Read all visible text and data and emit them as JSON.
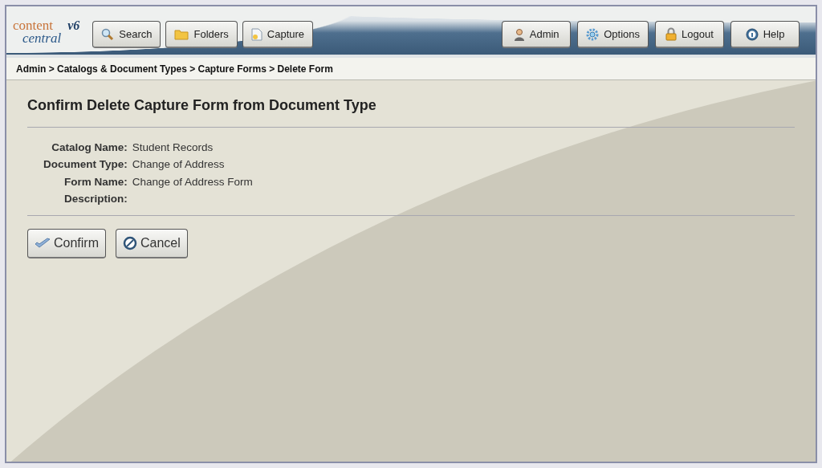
{
  "logo": {
    "line_1": "content",
    "line_2": "central",
    "version": "v6"
  },
  "nav_left": [
    {
      "label": "Search",
      "kind": "search"
    },
    {
      "label": "Folders",
      "kind": "folder"
    },
    {
      "label": "Capture",
      "kind": "document"
    }
  ],
  "nav_right": [
    {
      "label": "Admin",
      "kind": "person"
    },
    {
      "label": "Options",
      "kind": "gear"
    },
    {
      "label": "Logout",
      "kind": "lock"
    },
    {
      "label": "Help",
      "kind": "help"
    }
  ],
  "breadcrumb": "Admin > Catalogs & Document Types > Capture Forms > Delete Form",
  "title": "Confirm Delete Capture Form from Document Type",
  "fields": [
    {
      "label": "Catalog Name:",
      "value": "Student Records"
    },
    {
      "label": "Document Type:",
      "value": "Change of Address"
    },
    {
      "label": "Form Name:",
      "value": "Change of Address Form"
    },
    {
      "label": "Description:"
    }
  ],
  "actions": [
    {
      "label": "Confirm",
      "kind": "check"
    },
    {
      "label": "Cancel",
      "kind": "cancel"
    }
  ]
}
